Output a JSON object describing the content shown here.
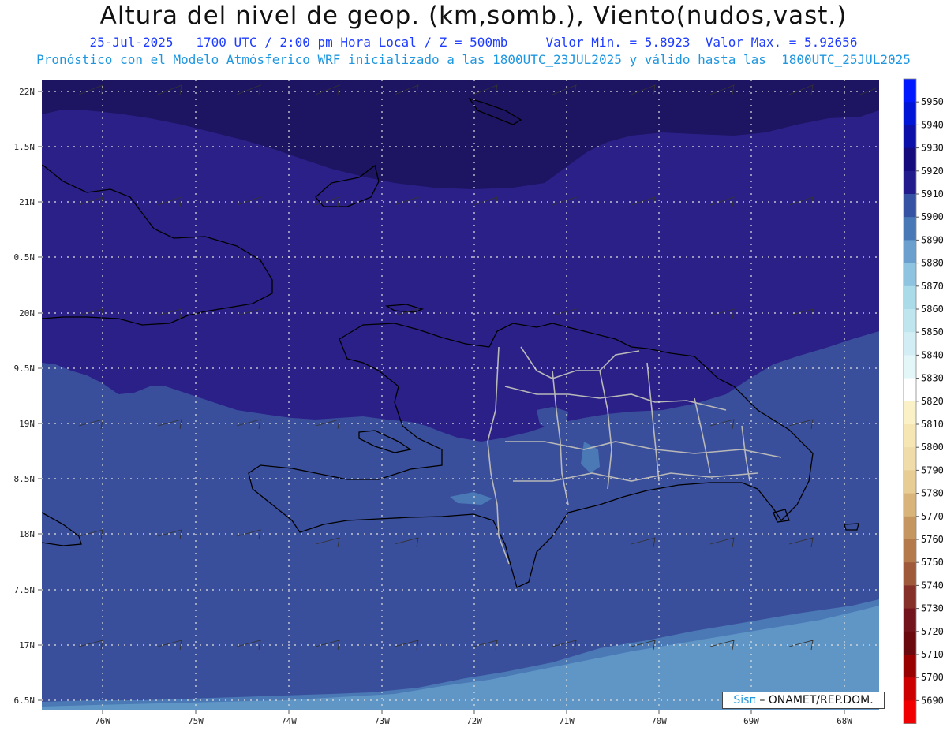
{
  "header": {
    "title": "Altura del nivel de geop. (km,somb.), Viento(nudos,vast.)",
    "date_line": "25-Jul-2025   1700 UTC / 2:00 pm Hora Local / Z = 500mb     Valor Min. = 5.8923  Valor Max. = 5.92656",
    "model_line": "Pronóstico con el Modelo Atmósferico WRF inicializado a las 1800UTC_23JUL2025 y válido hasta las  1800UTC_25JUL2025"
  },
  "map": {
    "lat_labels": [
      "22N",
      "1.5N",
      "21N",
      "0.5N",
      "20N",
      "9.5N",
      "19N",
      "8.5N",
      "18N",
      "7.5N",
      "17N",
      "6.5N"
    ],
    "lon_labels": [
      "76W",
      "75W",
      "74W",
      "73W",
      "72W",
      "71W",
      "70W",
      "69W",
      "68W"
    ],
    "shading_levels": {
      "5920": "#1d1462",
      "5910": "#2b2088",
      "5900": "#3a4f9c",
      "5890": "#4a79b5",
      "5880": "#5f96c5"
    }
  },
  "colorbar": {
    "labels": [
      "5950",
      "5940",
      "5930",
      "5920",
      "5910",
      "5900",
      "5890",
      "5880",
      "5870",
      "5860",
      "5850",
      "5840",
      "5830",
      "5820",
      "5810",
      "5800",
      "5790",
      "5780",
      "5770",
      "5760",
      "5750",
      "5740",
      "5730",
      "5720",
      "5710",
      "5700",
      "5690"
    ],
    "colors": [
      "#0019ff",
      "#0015d6",
      "#0d10a8",
      "#150b7c",
      "#231c8c",
      "#3653a3",
      "#4879b6",
      "#6a9fce",
      "#8fc4e0",
      "#a9dbe9",
      "#bfe6ef",
      "#d2eef4",
      "#e3f6f8",
      "#ffffff",
      "#fbf1c7",
      "#f5e6b4",
      "#efdca8",
      "#e7cc94",
      "#d9b47a",
      "#c69660",
      "#b57a4c",
      "#9e5a3a",
      "#86302a",
      "#73141c",
      "#6a0a0e",
      "#990000",
      "#cc0000",
      "#f00000"
    ]
  },
  "credit": {
    "brand": "Sisπ",
    "text": "– ONAMET/REP.DOM."
  }
}
